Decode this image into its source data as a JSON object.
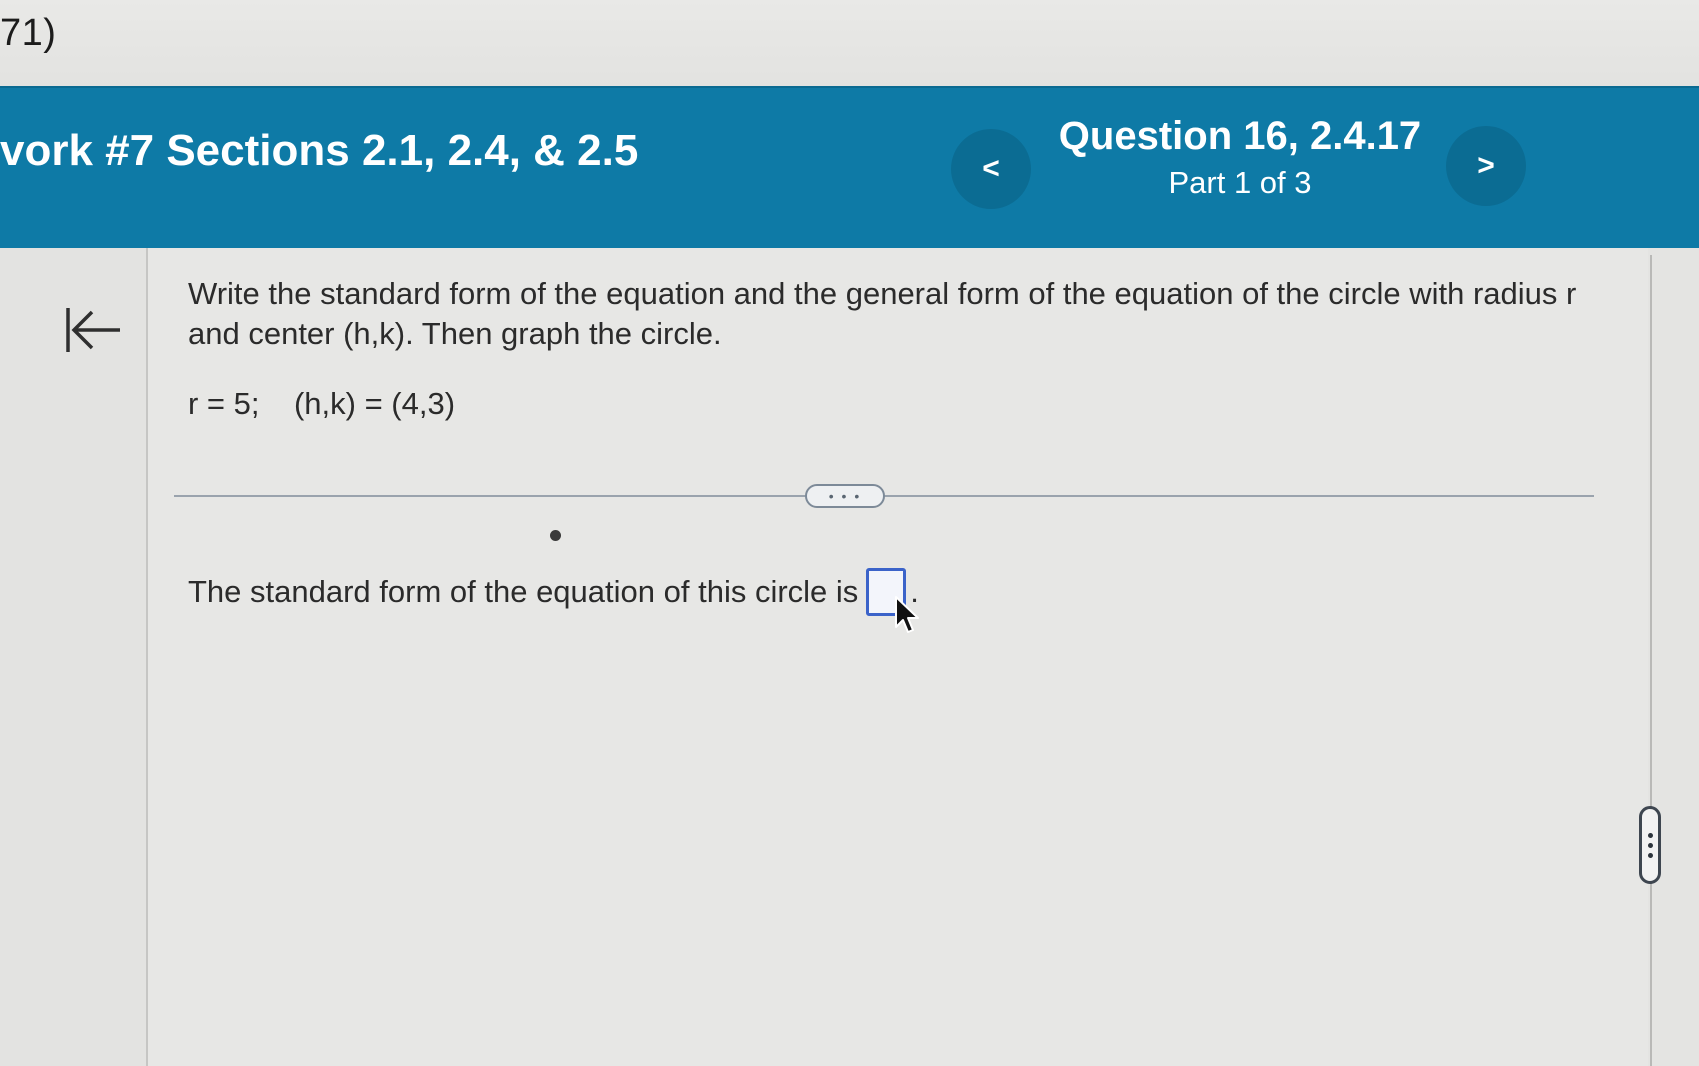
{
  "window": {
    "top_label": "71)"
  },
  "header": {
    "assignment_title": "vork #7 Sections 2.1, 2.4, & 2.5",
    "question_title": "Question 16, 2.4.17",
    "question_part": "Part 1 of 3",
    "prev_label": "<",
    "next_label": ">"
  },
  "question": {
    "prompt": "Write the standard form of the equation and the general form of the equation of the circle with radius r and center (h,k). Then graph the circle.",
    "given": "r = 5;    (h,k) = (4,3)",
    "expand_label": "• • •"
  },
  "answer": {
    "text_before": "The standard form of the equation of this circle is",
    "input_value": "",
    "text_after": "."
  },
  "icons": {
    "back": "back-to-start-icon",
    "cursor": "mouse-pointer-icon",
    "scroll": "scroll-handle-icon"
  },
  "colors": {
    "header_bg": "#0e7aa6",
    "nav_button_bg": "#0b6c93",
    "input_border": "#3b63c9"
  }
}
